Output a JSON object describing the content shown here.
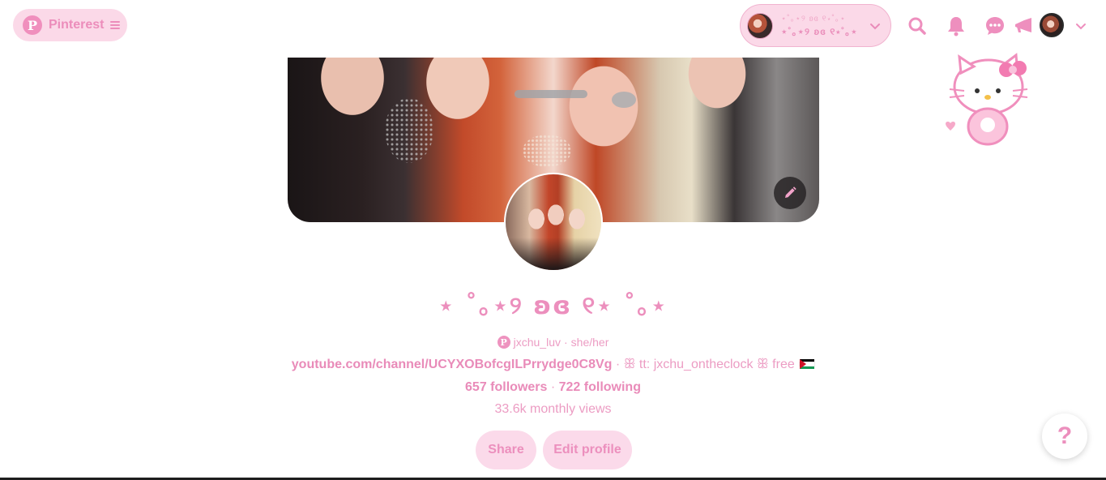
{
  "header": {
    "brand_label": "Pinterest",
    "brand_logo_letter": "P",
    "account": {
      "name_small": "⋆˚｡⋆୨ ʚɞ ୧⋆˚｡⋆",
      "name_big": "⋆˚｡⋆୨ ʚɞ ୧⋆˚｡⋆"
    },
    "icons": [
      "search-icon",
      "bell-icon",
      "messages-icon",
      "megaphone-icon"
    ]
  },
  "profile": {
    "display_name": "⋆ ˚｡⋆୨ ʚɞ ୧⋆ ˚｡⋆",
    "username": "jxchu_luv",
    "username_sep": " · ",
    "pronouns": "she/her",
    "bio_link": "youtube.com/channel/UCYXOBofcgILPrrydge0C8Vg",
    "bio_text": " · ꕥ tt: jxchu_ontheclock ꕥ free ",
    "followers": "657 followers",
    "stats_sep": " · ",
    "following": "722 following",
    "monthly_views": "33.6k monthly views"
  },
  "actions": {
    "share_label": "Share",
    "edit_profile_label": "Edit profile",
    "help_label": "?"
  },
  "colors": {
    "accent": "#ec8fbd",
    "pill_bg": "#fbd9e8"
  }
}
